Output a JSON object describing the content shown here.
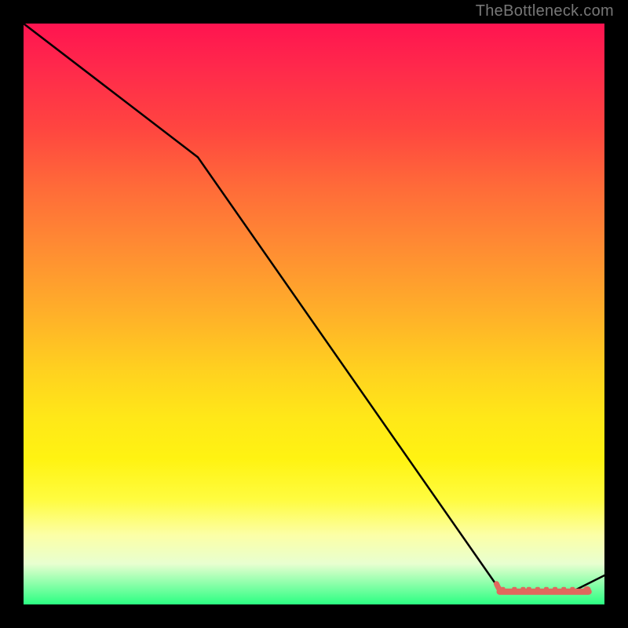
{
  "watermark": "TheBottleneck.com",
  "chart_data": {
    "type": "line",
    "title": "",
    "xlabel": "",
    "ylabel": "",
    "xlim": [
      0,
      100
    ],
    "ylim": [
      0,
      100
    ],
    "series": [
      {
        "name": "main-curve",
        "x": [
          0,
          30,
          82,
          86,
          90,
          94,
          100
        ],
        "values": [
          100,
          77,
          2.5,
          2,
          2,
          2,
          5
        ]
      }
    ],
    "flat_markers": {
      "y": 2.2,
      "x": [
        82.5,
        84.5,
        86,
        87,
        88.5,
        90,
        91.5,
        93,
        94.5,
        97
      ]
    }
  },
  "colors": {
    "curve": "#000000",
    "marker": "#e0675d",
    "background": "#000000"
  }
}
